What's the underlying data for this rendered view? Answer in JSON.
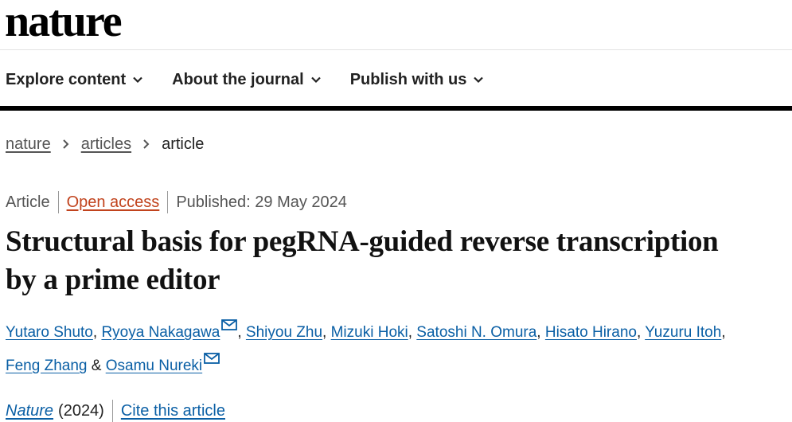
{
  "header": {
    "logo": "nature",
    "nav": [
      {
        "label": "Explore content",
        "icon": "chevron-down-icon"
      },
      {
        "label": "About the journal",
        "icon": "chevron-down-icon"
      },
      {
        "label": "Publish with us",
        "icon": "chevron-down-icon"
      }
    ]
  },
  "breadcrumb": {
    "items": [
      "nature",
      "articles"
    ],
    "current": "article"
  },
  "article": {
    "type": "Article",
    "access": "Open access",
    "published": "Published: 29 May 2024",
    "title": "Structural basis for pegRNA-guided reverse transcription by a prime editor",
    "authors": [
      {
        "name": "Yutaro Shuto"
      },
      {
        "name": "Ryoya Nakagawa",
        "mail_icon": "mail-icon"
      },
      {
        "name": "Shiyou Zhu"
      },
      {
        "name": "Mizuki Hoki"
      },
      {
        "name": "Satoshi N. Omura"
      },
      {
        "name": "Hisato Hirano"
      },
      {
        "name": "Yuzuru Itoh"
      },
      {
        "name": "Feng Zhang"
      },
      {
        "name": "Osamu Nureki",
        "mail_icon": "mail-icon"
      }
    ],
    "author_separator": ",",
    "author_conjunction": "&",
    "journal": "Nature",
    "year": "(2024)",
    "cite": "Cite this article"
  },
  "colors": {
    "link": "#0a5fa5",
    "open_access": "#c1431d",
    "text": "#222222"
  }
}
